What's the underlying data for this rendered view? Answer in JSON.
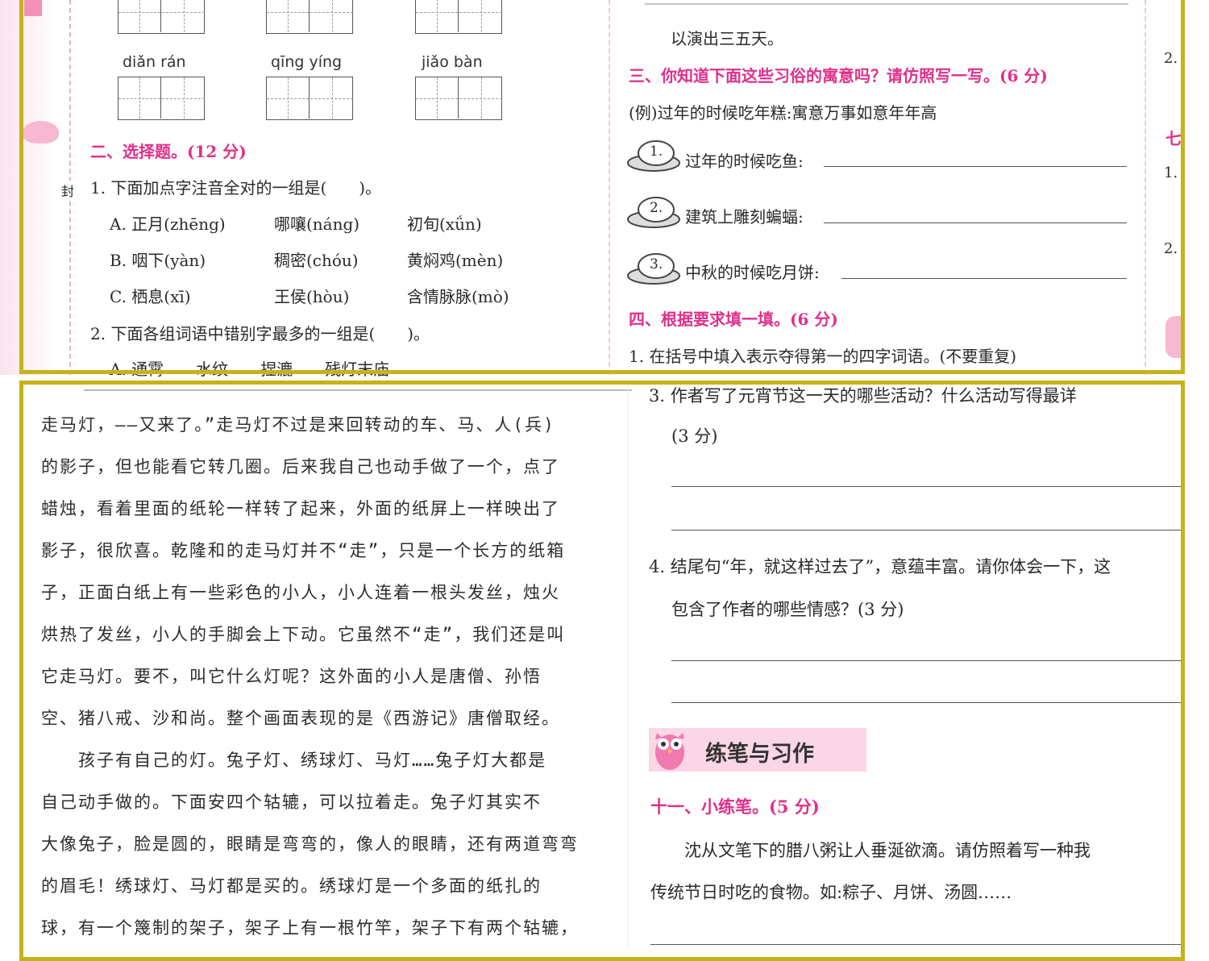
{
  "top_page": {
    "grid_row2": [
      {
        "pinyin": "diǎn rán"
      },
      {
        "pinyin": "qīng yíng"
      },
      {
        "pinyin": "jiǎo bàn"
      }
    ],
    "side_char": "封",
    "sec2_title": "二、选择题。(12 分)",
    "q1": "1. 下面加点字注音全对的一组是(　　)。",
    "q1_options": [
      {
        "a": "A. 正月(zhēng)",
        "b": "哪嚷(náng)",
        "c": "初旬(xǘn)"
      },
      {
        "a": "B. 咽下(yàn)",
        "b": "稠密(chóu)",
        "c": "黄焖鸡(mèn)"
      },
      {
        "a": "C. 栖息(xī)",
        "b": "王侯(hòu)",
        "c": "含情脉脉(mò)"
      }
    ],
    "q2": "2. 下面各组词语中错别字最多的一组是(　　)。",
    "q2_cut": "A. 通霄　　水纹　　捏漉　　残灯末庙",
    "right_top_line": "以演出三五天。",
    "sec3_title": "三、你知道下面这些习俗的寓意吗？请仿照写一写。(6 分)",
    "sec3_example": "(例)过年的时候吃年糕:寓意万事如意年年高",
    "sec3_items": [
      {
        "num": "1.",
        "text": "过年的时候吃鱼:"
      },
      {
        "num": "2.",
        "text": "建筑上雕刻蝙蝠:"
      },
      {
        "num": "3.",
        "text": "中秋的时候吃月饼:"
      }
    ],
    "sec4_title": "四、根据要求填一填。(6 分)",
    "sec4_q1": "1. 在括号中填入表示夺得第一的四字词语。(不要重复)",
    "far_right_marks": [
      "2.",
      "七",
      "1.",
      "2."
    ]
  },
  "bottom_page": {
    "story_lines": [
      "走马灯，——又来了。”走马灯不过是来回转动的车、马、人(兵)",
      "的影子，但也能看它转几圈。后来我自己也动手做了一个，点了",
      "蜡烛，看着里面的纸轮一样转了起来，外面的纸屏上一样映出了",
      "影子，很欣喜。乾隆和的走马灯并不“走”，只是一个长方的纸箱",
      "子，正面白纸上有一些彩色的小人，小人连着一根头发丝，烛火",
      "烘热了发丝，小人的手脚会上下动。它虽然不“走”，我们还是叫",
      "它走马灯。要不，叫它什么灯呢？这外面的小人是唐僧、孙悟",
      "空、猪八戒、沙和尚。整个画面表现的是《西游记》唐僧取经。",
      "　　孩子有自己的灯。兔子灯、绣球灯、马灯……兔子灯大都是",
      "自己动手做的。下面安四个轱辘，可以拉着走。兔子灯其实不",
      "大像兔子，脸是圆的，眼睛是弯弯的，像人的眼睛，还有两道弯弯",
      "的眉毛！绣球灯、马灯都是买的。绣球灯是一个多面的纸扎的",
      "球，有一个篾制的架子，架子上有一根竹竿，架子下有两个轱辘，"
    ],
    "q3_line1": "3. 作者写了元宵节这一天的哪些活动？什么活动写得最详",
    "q3_line2": "(3 分)",
    "q4_line1": "4. 结尾句“年，就这样过去了”，意蕴丰富。请你体会一下，这",
    "q4_line2": "包含了作者的哪些情感？(3 分)",
    "banner_title": "练笔与习作",
    "sec11_title": "十一、小练笔。(5 分)",
    "sec11_line1": "　　沈从文笔下的腊八粥让人垂涎欲滴。请仿照着写一种我",
    "sec11_line2": "传统节日时吃的食物。如:粽子、月饼、汤圆……"
  },
  "colors": {
    "frame": "#c6b21a",
    "accent_pink": "#e0308a",
    "pink_light": "#fde4ef"
  }
}
